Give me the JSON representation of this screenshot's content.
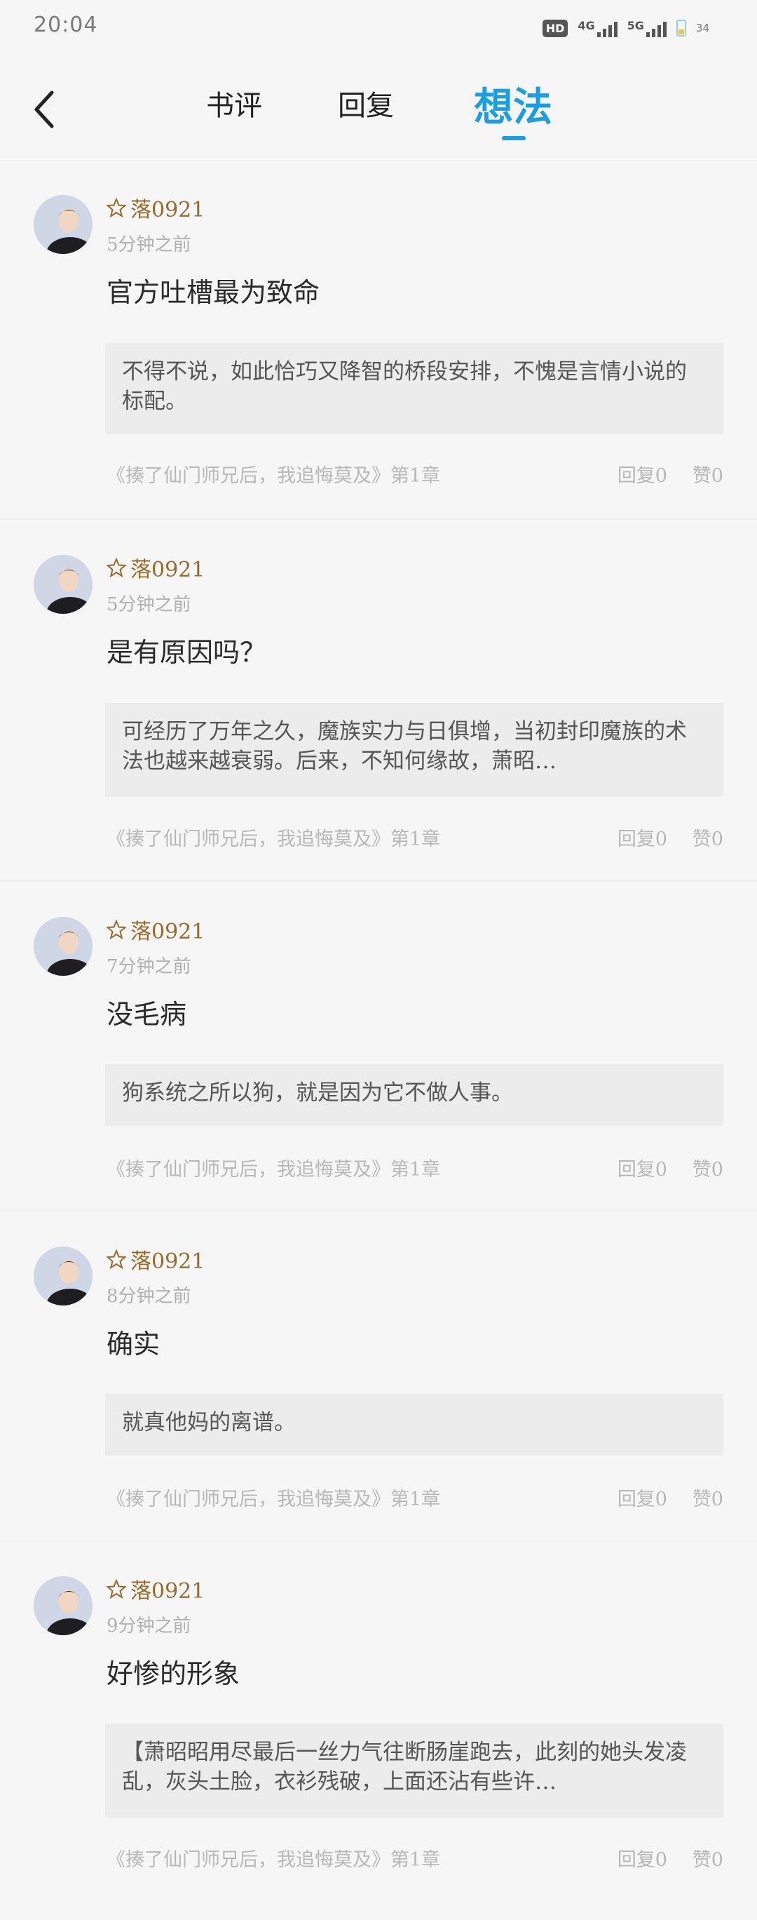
{
  "status_bar": {
    "time": "20:04",
    "hd_label": "HD",
    "sim_index": "1\n2",
    "network_1": "4G",
    "network_2": "5G",
    "battery_level": "34"
  },
  "tabs": {
    "reviews": "书评",
    "replies": "回复",
    "thoughts": "想法",
    "active": "thoughts",
    "accent_color": "#1a9ee0"
  },
  "posts": [
    {
      "username": "落0921",
      "time": "5分钟之前",
      "title": "官方吐槽最为致命",
      "quote": "不得不说，如此恰巧又降智的桥段安排，不愧是言情小说的标配。",
      "book_ref": "《揍了仙门师兄后，我追悔莫及》第1章",
      "replies": "回复0",
      "likes": "赞0"
    },
    {
      "username": "落0921",
      "time": "5分钟之前",
      "title": "是有原因吗？",
      "quote": "可经历了万年之久，魔族实力与日俱增，当初封印魔族的术法也越来越衰弱。后来，不知何缘故，萧昭…",
      "book_ref": "《揍了仙门师兄后，我追悔莫及》第1章",
      "replies": "回复0",
      "likes": "赞0"
    },
    {
      "username": "落0921",
      "time": "7分钟之前",
      "title": "没毛病",
      "quote": "狗系统之所以狗，就是因为它不做人事。",
      "book_ref": "《揍了仙门师兄后，我追悔莫及》第1章",
      "replies": "回复0",
      "likes": "赞0"
    },
    {
      "username": "落0921",
      "time": "8分钟之前",
      "title": "确实",
      "quote": "就真他妈的离谱。",
      "book_ref": "《揍了仙门师兄后，我追悔莫及》第1章",
      "replies": "回复0",
      "likes": "赞0"
    },
    {
      "username": "落0921",
      "time": "9分钟之前",
      "title": "好惨的形象",
      "quote": "【萧昭昭用尽最后一丝力气往断肠崖跑去，此刻的她头发凌乱，灰头土脸，衣衫残破，上面还沾有些许…",
      "book_ref": "《揍了仙门师兄后，我追悔莫及》第1章",
      "replies": "回复0",
      "likes": "赞0"
    }
  ]
}
